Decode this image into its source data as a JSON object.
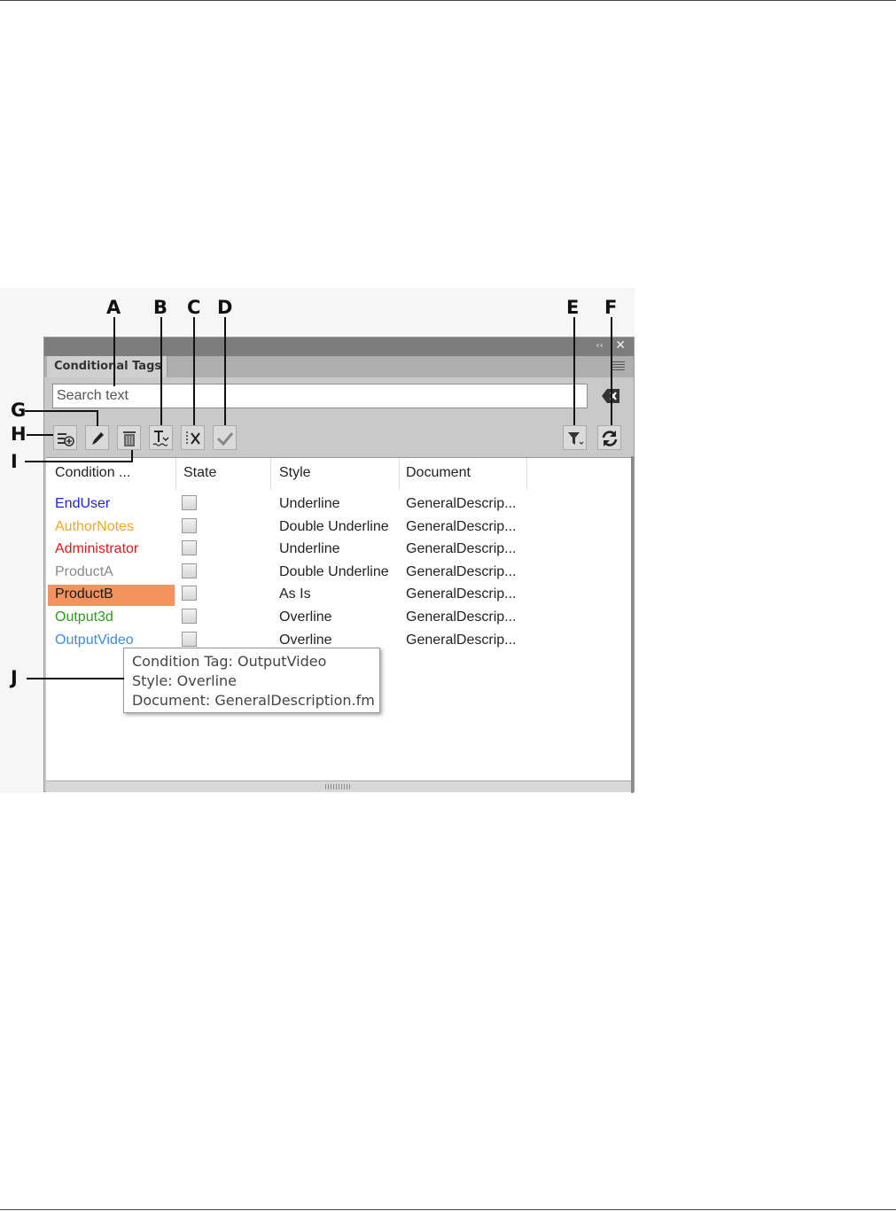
{
  "panel": {
    "tab_title": "Conditional Tags",
    "search_placeholder": "Search text"
  },
  "columns": [
    "Condition ...",
    "State",
    "Style",
    "Document"
  ],
  "rows": [
    {
      "condition": "EndUser",
      "color": "#1f24e8",
      "style": "Underline",
      "document": "GeneralDescrip..."
    },
    {
      "condition": "AuthorNotes",
      "color": "#f5a623",
      "style": "Double Underline",
      "document": "GeneralDescrip..."
    },
    {
      "condition": "Administrator",
      "color": "#e8151a",
      "style": "Underline",
      "document": "GeneralDescrip..."
    },
    {
      "condition": "ProductA",
      "color": "#8a8a8a",
      "style": "Double Underline",
      "document": "GeneralDescrip..."
    },
    {
      "condition": "ProductB",
      "color": "#1a1a1a",
      "style": "As Is",
      "document": "GeneralDescrip...",
      "selected": true
    },
    {
      "condition": "Output3d",
      "color": "#2e9a1e",
      "style": "Overline",
      "document": "GeneralDescrip..."
    },
    {
      "condition": "OutputVideo",
      "color": "#3a8ce6",
      "style": "Overline",
      "document": "GeneralDescrip..."
    }
  ],
  "tooltip": {
    "line1": "Condition Tag: OutputVideo",
    "line2": "Style: Overline",
    "line3": "Document: GeneralDescription.fm"
  },
  "callouts": {
    "A": "A",
    "B": "B",
    "C": "C",
    "D": "D",
    "E": "E",
    "F": "F",
    "G": "G",
    "H": "H",
    "I": "I",
    "J": "J"
  },
  "icons": [
    "new-tag-icon",
    "edit-icon",
    "trash-icon",
    "apply-style-icon",
    "remove-tags-icon",
    "check-icon",
    "filter-icon",
    "refresh-icon",
    "clear-search-icon",
    "close-icon",
    "collapse-icon",
    "panel-menu-icon"
  ]
}
